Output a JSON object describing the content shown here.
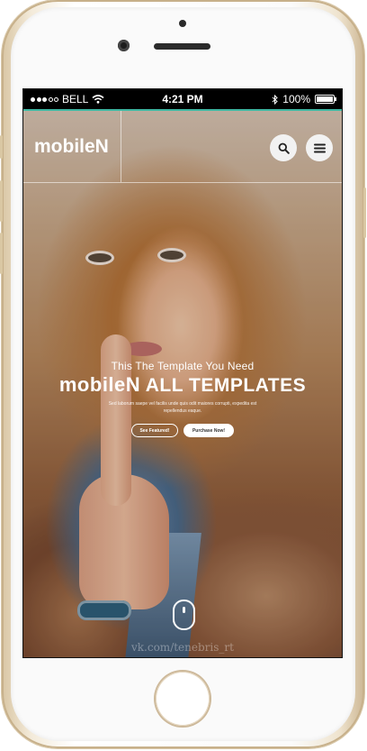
{
  "status_bar": {
    "carrier": "BELL",
    "time": "4:21 PM",
    "battery": "100%"
  },
  "header": {
    "logo": "mobileN",
    "search_icon": "search-icon",
    "menu_icon": "menu-icon"
  },
  "hero": {
    "subtitle": "This The Template You Need",
    "title_part1": "mobileN",
    "title_part2": " ALL TEMPLATES",
    "description": "Sed laborum saepe vel facilis unde quis odit maiores corrupti, expedita est repellendus eaque.",
    "button_primary": "See Featured!",
    "button_secondary": "Purchase Now!"
  },
  "watermark": "vk.com/tenebris_rt",
  "colors": {
    "accent": "#3fb8a3",
    "status_bar": "#000000",
    "phone_gold": "#d9c6a4"
  }
}
